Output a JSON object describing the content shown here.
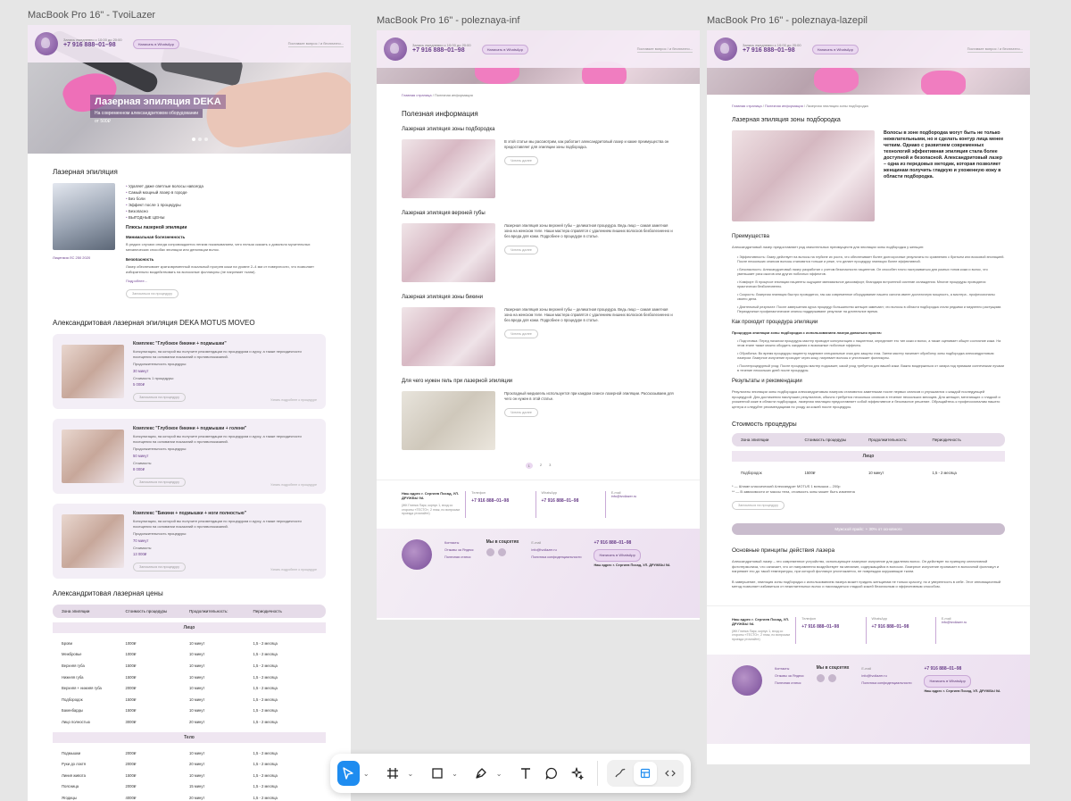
{
  "frames": {
    "f1": "MacBook Pro 16\" - TvoiLazer",
    "f2": "MacBook Pro 16\" - poleznaya-inf",
    "f3": "MacBook Pro 16\" - poleznaya-lazepil"
  },
  "header": {
    "hours": "Запись ежедневно с 10:00 до 20:00",
    "phone": "+7 916 888–01–98",
    "whatsapp": "Написать в WhatsApp",
    "search": "Поставьте вопрос / и бесплатно..."
  },
  "hero": {
    "title": "Лазерная эпиляция DEKA",
    "subtitle": "На современном александритовом оборудовании",
    "price": "от 500₽"
  },
  "epilation": {
    "title": "Лазерная эпиляция",
    "bullets": [
      "Удаляет даже светлые волосы навсегда",
      "Самый мощный лазер в городе",
      "Без боли",
      "Эффект после 1 процедуры",
      "Безопасно",
      "ВЫГОДНЫЕ ЦЕНЫ"
    ],
    "pluses_title": "Плюсы лазерной эпиляции",
    "p1_title": "Минимальная болезненность",
    "p1_text": "В редких случаях иногда сопровождается легким покалыванием, чего нельзя сказать о довольно мучительных механических способах эпиляции или депиляции волос.",
    "p2_title": "Безопасность",
    "p2_text": "Лазер обеспечивает кратковременный локальный прогрев кожи на уровне 2–4 мм от поверхности, что позволяет избирательно воздействовать на волосяные фолликулы (не нагревает ткани).",
    "more": "Подробнее...",
    "cert": "Лицензия ЛС 250 2020",
    "btn": "Записаться на процедуру"
  },
  "complex": {
    "title": "Александритовая лазерная эпиляция DEKA MOTUS MOVEO",
    "items": [
      {
        "title": "Комплекс \"Глубокое бикини + подмышки\"",
        "text": "Консультация, на которой вы получите рекомендации по процедурам и курсу, а также периодичности посещения на основании показаний и противопоказаний.",
        "dur_label": "Продолжительность процедуры:",
        "dur": "30 минут",
        "cost_label": "Стоимость 1 процедуры:",
        "cost": "5 000₽",
        "btn": "Записаться на процедуру",
        "more": "Узнать подробнее о процедуре"
      },
      {
        "title": "Комплекс \"Глубокое бикини + подмышки + голени\"",
        "text": "Консультация, на которой вы получите рекомендации по процедурам и курсу, а также периодичности посещения на основании показаний и противопоказаний.",
        "dur_label": "Продолжительность процедуры:",
        "dur": "50 минут",
        "cost_label": "Стоимость:",
        "cost": "8 000₽",
        "btn": "Записаться на процедуру",
        "more": "Узнать подробнее о процедуре"
      },
      {
        "title": "Комплекс \"Бикини + подмышки + ноги полностью\"",
        "text": "Консультация, на которой вы получите рекомендации по процедурам и курсу, а также периодичности посещения на основании показаний и противопоказаний.",
        "dur_label": "Продолжительность процедуры:",
        "dur": "70 минут",
        "cost_label": "Стоимость:",
        "cost": "13 000₽",
        "btn": "Записаться на процедуру",
        "more": "Узнать подробнее о процедуре"
      }
    ]
  },
  "prices": {
    "title": "Александритовая лазерная цены",
    "head": [
      "Зона эпиляции",
      "Стоимость процедуры",
      "Продолжительность:",
      "Периодичность"
    ],
    "face_label": "Лицо",
    "face": [
      [
        "Брови",
        "1000₽",
        "10 минут",
        "1,5 - 2 месяца"
      ],
      [
        "Межбровье",
        "1000₽",
        "10 минут",
        "1,5 - 2 месяца"
      ],
      [
        "Верхняя губа",
        "1500₽",
        "10 минут",
        "1,5 - 2 месяца"
      ],
      [
        "Нижняя губа",
        "1500₽",
        "10 минут",
        "1,5 - 2 месяца"
      ],
      [
        "Верхняя + нижняя губа",
        "2000₽",
        "10 минут",
        "1,5 - 2 месяца"
      ],
      [
        "Подбородок",
        "1500₽",
        "10 минут",
        "1,5 - 2 месяца"
      ],
      [
        "Бакенбарды",
        "1500₽",
        "10 минут",
        "1,5 - 2 месяца"
      ],
      [
        "Лицо полностью",
        "3000₽",
        "20 минут",
        "1,5 - 2 месяца"
      ]
    ],
    "body_label": "Тело",
    "body": [
      [
        "Подмышки",
        "2000₽",
        "10 минут",
        "1,5 - 2 месяца"
      ],
      [
        "Руки до локтя",
        "2000₽",
        "20 минут",
        "1,5 - 2 месяца"
      ],
      [
        "Линия живота",
        "1500₽",
        "10 минут",
        "1,5 - 2 месяца"
      ],
      [
        "Поясница",
        "2000₽",
        "15 минут",
        "1,5 - 2 месяца"
      ],
      [
        "Ягодицы",
        "4000₽",
        "20 минут",
        "1,5 - 2 месяца"
      ]
    ]
  },
  "info": {
    "crumb_home": "Главная страница",
    "crumb_cur": "Полезная информация",
    "title": "Полезная информация",
    "articles": [
      {
        "title": "Лазерная эпиляция зоны подбородка",
        "text": "В этой статье мы рассмотрим, как работает александритовый лазер и какие преимущества он предоставляет для эпиляции зоны подбородка.",
        "btn": "Читать далее"
      },
      {
        "title": "Лазерная эпиляция верхней губы",
        "text": "Лазерная эпиляция зоны верхней губы – деликатная процедура. Ведь лицо – самая заметная зона на женском теле. Наши мастера справятся с удалением лишних волосков безболезненно и без вреда для кожи. Подробнее о процедуре в статье.",
        "btn": "Читать далее"
      },
      {
        "title": "Лазерная эпиляция зоны бикини",
        "text": "Лазерная эпиляция зоны верхней губы – деликатная процедура. Ведь лицо – самая заметная зона на женском теле. Наши мастера справятся с удалением лишних волосков безболезненно и без вреда для кожи. Подробнее о процедуре в статье.",
        "btn": "Читать далее"
      },
      {
        "title": "Для чего нужен гель при лазерной эпиляции",
        "text": "Прохладный медиагель используется при каждом сеансе лазерной эпиляции. Рассказываем для чего он нужен в этой статье.",
        "btn": "Читать далее"
      }
    ],
    "pages": [
      "1",
      "2",
      "3"
    ]
  },
  "contacts": {
    "addr": "Наш адрес г. Сергиев Посад, УЛ. ДРУЖБЫ 9А",
    "addr_note": "(ЖК Глинка Парк, корпус 1, вход со стороны «ТЕСТО», 2 этаж, по вопросам проезда уточняйте)",
    "phone_label": "Телефон",
    "phone": "+7 916 888–01–98",
    "wa_label": "WhatsApp",
    "wa": "+7 916 888–01–98",
    "email_label": "E-mail",
    "email": "info@tvoilazer.ru"
  },
  "footer": {
    "links": [
      "Контакты",
      "Отзывы за Яндекс",
      "Полезная статья"
    ],
    "social": "Мы в соцсетях",
    "email_label": "E-mail",
    "email": "info@tvoilazer.ru",
    "policy": "Политика конфиденциальности",
    "phone": "+7 916 888–01–98",
    "wa": "Написать в WhatsApp",
    "addr": "Наш адрес г. Сергиев Посад, УЛ. ДРУЖБЫ 9А"
  },
  "chin": {
    "crumb_home": "Главная страница",
    "crumb_mid": "Полезная информация",
    "crumb_cur": "Лазерная эпиляция зоны подбородка",
    "title": "Лазерная эпиляция зоны подбородка",
    "intro": "Волосы в зоне подбородка могут быть не только нежелательными, но и сделать контур лица менее четким. Однако с развитием современных технологий эффективная эпиляция стала более доступной и безопасной. Александритовый лазер – одна из передовых методик, которая позволяет женщинам получить гладкую и ухоженную кожу в области подбородка.",
    "adv_title": "Преимущества",
    "adv_lead": "Александритовый лазер предоставляет ряд значительных преимуществ для эпиляции зоны подбородка у женщин:",
    "adv": [
      "Эффективность: Лазер действует на волосы на глубине их роста, что обеспечивает более долгосрочные результаты по сравнению с бритьем или восковой эпиляцией. После нескольких сеансов волосы становятся тоньше и реже, что делает процедуру эпиляции более эффективной.",
      "Безопасность: Александритовый лазер разработан с учетом безопасности пациентов. Он способен точно настраиваться для разных типов кожи и волос, что уменьшает риск ожогов или других побочных эффектов.",
      "Комфорт: В процессе эпиляции пациенты ощущают минимальное дискомфорт, благодаря встроенной системе охлаждения. Многие процедуры проводятся практически безболезненно.",
      "Скорость: Лазерная эпиляция быстро проводится, так как современное оборудование нашего салона имеет достаточную мощность, а мастера - профессионалы своего дела.",
      "Длительный результат: После завершения курса процедур большинство женщин замечают, что волосы в области подбородка стали редкими и медленно растущими. Периодичные профилактические сеансы поддерживают результат на длительное время."
    ],
    "how_title": "Как проходит процедура эпиляции",
    "how_lead": "Процедура эпиляции зоны подбородка с использованием лазера довольно проста:",
    "how": [
      "Подготовка: Перед началом процедуры мастер проводит консультацию с пациентом, определяет его тип кожи и волос, а также оценивает общее состояние кожи. На этом этапе также можно обсудить ожидания и возможные побочные эффекты.",
      "Обработка: Во время процедуры пациенту надевают специальные очки для защиты глаз. Затем мастер начинает обработку зоны подбородка александритовым лазером. Лазерное излучение проходит через кожу, нагревает волосы и уничтожает фолликулы.",
      "Послепроцедурный уход: После процедуры мастер подскажет, какой уход требуется для вашей кожи. Важно воздержаться от загара под прямыми солнечными лучами в течение нескольких дней после процедуры."
    ],
    "res_title": "Результаты и рекомендации",
    "res_text": "Результаты эпиляции зоны подбородка александритовым лазером становятся заметными после первых сеансов и улучшаются с каждой последующей процедурой. Для достижения наилучших результатов, обычно требуется несколько сеансов в течение нескольких месяцев. Для женщин, мечтающих о гладкой и ухоженной коже в области подбородка, лазерная эпиляция предоставляет собой эффективное и безопасное решение. Обращайтесь к профессионалам нашего центра и следуйте рекомендациям по уходу за кожей после процедуры.",
    "cost_title": "Стоимость процедуры",
    "head": [
      "Зона эпиляции",
      "Стоимость процедуры",
      "Продолжительность:",
      "Периодичность"
    ],
    "cat": "Лицо",
    "row": [
      "Подбородок",
      "1500₽",
      "10 минут",
      "1,5 - 2 месяца"
    ],
    "note1": "* — Штамп классический Александрит MOTUS 1 вспышка – 200р",
    "note2": "** — В зависимости от массы тела, стоимость зоны может быть изменена",
    "btn": "Записаться на процедуру",
    "promo": "Мужской прайс: + 30% от основного",
    "prin_title": "Основные принципы действия лазера",
    "prin1": "Александритовый лазер – это современное устройство, использующее лазерное излучение для удаления волос. Он действует по принципу селективной фототермолиза, что означает, что он направленно воздействует на меланин, содержащийся в волосах. Лазерное излучение проникает в волосяной фолликул и нагревает его до такой температуры, при которой фолликул уничтожается, не повреждая окружающие ткани.",
    "prin2": "В завершение, эпиляция зоны подбородка с использованием лазера может придать женщинам не только красоту, но и уверенность в себе. Этот инновационный метод позволяет избавиться от нежелательных волос и наслаждаться гладкой кожей безопасным и эффективным способом."
  },
  "toolbar": {
    "tools": [
      "select-tool",
      "frame-tool",
      "shape-tool",
      "pen-tool",
      "text-tool",
      "comment-tool",
      "actions-tool"
    ],
    "modes": [
      "draw-mode",
      "design-mode",
      "dev-mode"
    ]
  }
}
